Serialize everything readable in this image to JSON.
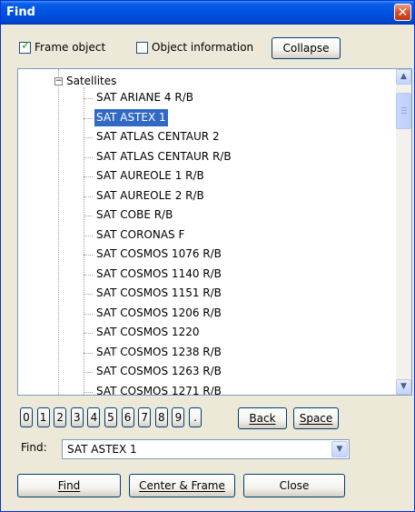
{
  "window": {
    "title": "Find",
    "close_glyph": "✕"
  },
  "options": {
    "frame_object": {
      "label": "Frame object",
      "checked": true
    },
    "object_information": {
      "label": "Object information",
      "checked": false
    },
    "collapse_label": "Collapse"
  },
  "tree": {
    "root_label": "Satellites",
    "items": [
      "SAT ARIANE 4 R/B",
      "SAT ASTEX 1",
      "SAT ATLAS CENTAUR 2",
      "SAT ATLAS CENTAUR R/B",
      "SAT AUREOLE 1 R/B",
      "SAT AUREOLE 2 R/B",
      "SAT COBE R/B",
      "SAT CORONAS F",
      "SAT COSMOS 1076 R/B",
      "SAT COSMOS 1140 R/B",
      "SAT COSMOS 1151 R/B",
      "SAT COSMOS 1206 R/B",
      "SAT COSMOS 1220",
      "SAT COSMOS 1238 R/B",
      "SAT COSMOS 1263 R/B",
      "SAT COSMOS 1271 R/B"
    ],
    "selected": "SAT ASTEX 1"
  },
  "keypad": {
    "digits": [
      "0",
      "1",
      "2",
      "3",
      "4",
      "5",
      "6",
      "7",
      "8",
      "9",
      "."
    ],
    "back_label": "Back",
    "space_label": "Space"
  },
  "find_field": {
    "label": "Find:",
    "value": "SAT ASTEX 1"
  },
  "buttons": {
    "find": "Find",
    "center_frame": "Center & Frame",
    "close": "Close"
  }
}
